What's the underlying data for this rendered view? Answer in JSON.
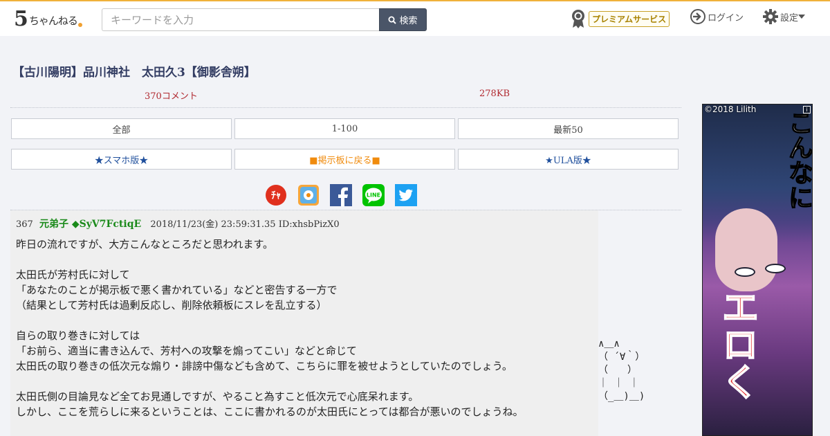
{
  "header": {
    "logo_mark": "5",
    "logo_text": "ちゃんねる",
    "search_placeholder": "キーワードを入力",
    "search_button": "検索",
    "premium_label": "プレミアムサービス",
    "login_label": "ログイン",
    "settings_label": "設定"
  },
  "thread": {
    "title": "【古川陽明】品川神社　太田久3【御影舎朔】",
    "comments": "370コメント",
    "size": "278KB"
  },
  "nav": {
    "all": "全部",
    "range": "1-100",
    "latest": "最新50",
    "smartphone": "★スマホ版★",
    "back_to_board": "■掲示板に戻る■",
    "ula": "★ULA版★"
  },
  "share": {
    "icons": [
      "five-ch-icon",
      "blog-icon",
      "facebook-icon",
      "line-icon",
      "twitter-icon"
    ],
    "line_label": "LINE"
  },
  "post": {
    "number": "367",
    "name": "元弟子 ◆SyV7FctiqE",
    "datetime": "2018/11/23(金) 23:59:31.35",
    "id": "ID:xhsbPizX0",
    "paragraphs": [
      [
        "昨日の流れですが、大方こんなところだと思われます。"
      ],
      [
        "太田氏が芳村氏に対して",
        "「あなたのことが掲示板で悪く書かれている」などと密告する一方で",
        "（結果として芳村氏は過剰反応し、削除依頼板にスレを乱立する）"
      ],
      [
        "自らの取り巻きに対しては",
        "「お前ら、適当に書き込んで、芳村への攻撃を煽ってこい」などと命じて",
        "太田氏の取り巻きの低次元な煽り・誹謗中傷なども含めて、こちらに罪を被せようとしていたのでしょう。"
      ],
      [
        "太田氏側の目論見など全てお見通しですが、やること為すこと低次元で心底呆れます。",
        "しかし、ここを荒らしに来るということは、ここに書かれるのが太田氏にとっては都合が悪いのでしょうね。"
      ]
    ]
  },
  "ascii_art": "∧＿∧\n（ ´∀｀）\n（　　）\n｜ ｜ ｜\n（_＿)＿)",
  "ad": {
    "copyright": "©2018 Lilith",
    "info": "i",
    "text_top": "こんなに",
    "text_red": "エロく",
    "colors": {
      "red": "#e02020"
    }
  },
  "colors": {
    "title": "#333d63",
    "meta": "#b0282f",
    "name": "#1a8a1a",
    "link_blue": "#1f4f9c",
    "link_orange": "#f08b0d",
    "header_accent": "#f0b13a"
  }
}
